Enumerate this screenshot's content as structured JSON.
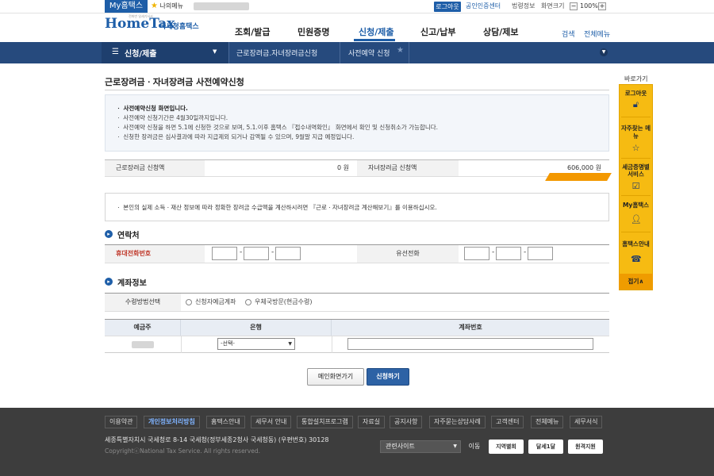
{
  "topbar": {
    "my_hometax": "My홈택스",
    "my_menu": "나의메뉴",
    "logout": "로그아웃",
    "cert_center": "공인인증센터",
    "law_info": "법령정보",
    "zoom_label": "화면크기",
    "zoom_value": "100%",
    "zoom_minus": "−",
    "zoom_plus": "+"
  },
  "header": {
    "logo_main": "HomeTax",
    "logo_sub": "국세청홈택스",
    "logo_tag": "전화번 일세기서서",
    "nav": [
      "조회/발급",
      "민원증명",
      "신청/제출",
      "신고/납부",
      "상담/제보"
    ],
    "active_nav": "신청/제출",
    "search": "검색",
    "all_menu": "전체메뉴"
  },
  "location": {
    "menu_title": "신청/제출",
    "crumb2": "근로장려금.자녀장려금신청",
    "crumb3": "사전예약 신청"
  },
  "page": {
    "title": "근로장려금ㆍ자녀장려금 사전예약신청",
    "notices": [
      "ㆍ 사전예약신청 화면입니다.",
      "ㆍ 사전예약 신청기간은 4월30일까지입니다.",
      "ㆍ 사전예약 신청을 하면 5.1에 신청한 것으로 보며, 5.1.이후 홈택스 『접수내역확인』 화면에서 확인 및 신청취소가 가능합니다.",
      "ㆍ 신청한 장려금은 심사결과에 따라 지급제외 되거나 감액될 수 있으며, 9월말 지급 예정입니다."
    ],
    "amounts": {
      "eitc_label": "근로장려금 신청액",
      "eitc_value": "0 원",
      "ctc_label": "자녀장려금 신청액",
      "ctc_value": "606,000 원"
    },
    "calc_notice": "ㆍ 본인의 실제 소득ㆍ재산 정보에 따라 정확한 장려금 수급액을 계산하시려면 『근로ㆍ자녀장려금 계산해보기』를 이용하십시오.",
    "contact": {
      "section_title": "연락처",
      "mobile_label": "휴대전화번호",
      "landline_label": "유선전화"
    },
    "account": {
      "section_title": "계좌정보",
      "method_label": "수령방법선택",
      "option1": "신청자예금계좌",
      "option2": "우체국방문(현금수령)",
      "col_holder": "예금주",
      "col_bank": "은행",
      "col_number": "계좌번호",
      "bank_selected": "-선택-"
    },
    "buttons": {
      "main_page": "메인화면가기",
      "apply": "신청하기"
    }
  },
  "quickbar": {
    "label": "바로가기",
    "items": [
      "로그아웃",
      "자주찾는 메뉴",
      "세금증명별 서비스",
      "My홈택스",
      "홈택스안내"
    ],
    "close": "접기∧"
  },
  "footer": {
    "links": [
      "이용약관",
      "개인정보처리방침",
      "홈택스안내",
      "세무서 안내",
      "통합설치프로그램",
      "자료실",
      "공지사항",
      "자주묻는상담사례",
      "고객센터",
      "전체메뉴",
      "세무서식"
    ],
    "address": "세종특별자치시 국세청로 8-14 국세청(정부세종2청사 국세청동) (우편번호) 30128",
    "copyright": "CopyrightⓒNational Tax Service. All rights reserved.",
    "related_sites": "관련사이트",
    "go": "이동",
    "banner1": "지역별회",
    "banner2": "달세1달",
    "banner3": "원격지원"
  }
}
